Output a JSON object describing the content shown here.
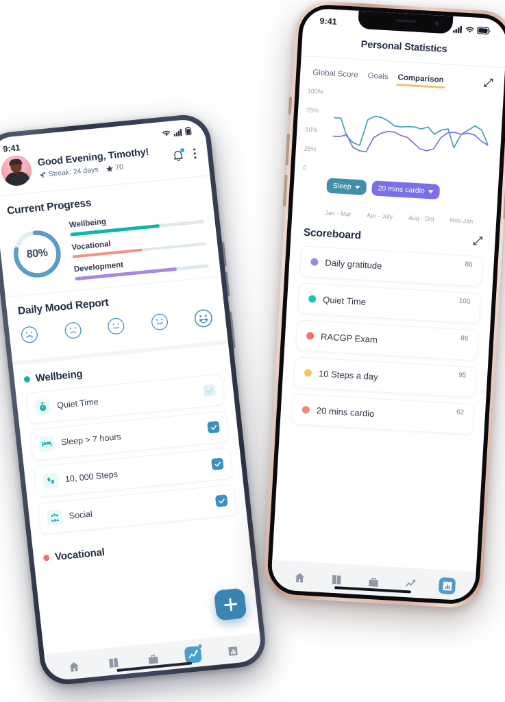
{
  "left_phone": {
    "status": {
      "time": "9:41",
      "icons": [
        "wifi-icon",
        "signal-icon",
        "battery-icon"
      ]
    },
    "header": {
      "greeting": "Good Evening, Timothy!",
      "streak_label": "Streak: 24 days",
      "streak_icon": "rocket-icon",
      "points": "70",
      "points_icon": "star-icon",
      "bell_icon": "bell-icon",
      "menu_icon": "kebab-menu-icon"
    },
    "progress": {
      "title": "Current Progress",
      "donut_value": "80%",
      "donut_percent": 80,
      "donut_color": "#5d9cc4",
      "bars": [
        {
          "label": "Wellbeing",
          "percent": 67,
          "color": "#0fb6b0"
        },
        {
          "label": "Vocational",
          "percent": 52,
          "color": "#f29189"
        },
        {
          "label": "Development",
          "percent": 76,
          "color": "#a78ae0"
        }
      ]
    },
    "mood": {
      "title": "Daily Mood Report",
      "faces": [
        {
          "name": "mood-sad-icon",
          "selected": false
        },
        {
          "name": "mood-slightly-sad-icon",
          "selected": false
        },
        {
          "name": "mood-neutral-icon",
          "selected": false
        },
        {
          "name": "mood-slightly-happy-icon",
          "selected": false
        },
        {
          "name": "mood-very-happy-icon",
          "selected": true
        }
      ]
    },
    "categories": [
      {
        "name": "Wellbeing",
        "color": "#0fb6b0",
        "tasks": [
          {
            "label": "Quiet Time",
            "icon": "stopwatch-icon",
            "checked": false
          },
          {
            "label": "Sleep > 7 hours",
            "icon": "bed-icon",
            "checked": true
          },
          {
            "label": "10, 000 Steps",
            "icon": "footsteps-icon",
            "checked": true
          },
          {
            "label": "Social",
            "icon": "people-icon",
            "checked": true
          }
        ]
      },
      {
        "name": "Vocational",
        "color": "#f2716d",
        "tasks": []
      }
    ],
    "fab": {
      "label": "+",
      "icon": "plus-icon"
    },
    "tabbar": [
      {
        "name": "tab-home",
        "icon": "home-icon",
        "active": false
      },
      {
        "name": "tab-journal",
        "icon": "book-icon",
        "active": false
      },
      {
        "name": "tab-toolkit",
        "icon": "briefcase-icon",
        "active": false
      },
      {
        "name": "tab-progress",
        "icon": "trend-up-icon",
        "active": true
      },
      {
        "name": "tab-stats",
        "icon": "bar-chart-icon",
        "active": false
      }
    ]
  },
  "right_phone": {
    "status": {
      "time": "9:41",
      "icons": [
        "signal-icon",
        "wifi-icon",
        "battery-icon"
      ]
    },
    "title": "Personal Statistics",
    "tabs": [
      {
        "label": "Global Score",
        "active": false
      },
      {
        "label": "Goals",
        "active": false
      },
      {
        "label": "Comparison",
        "active": true
      }
    ],
    "tab_underline_color": "#f7bf63",
    "expand_icon": "expand-diagonal-icon",
    "selectors": [
      {
        "label": "Sleep",
        "color": "#3f8fa8",
        "icon": "chevron-down-icon"
      },
      {
        "label": "20 mins cardio",
        "color": "#7b6fe8",
        "icon": "chevron-down-icon"
      }
    ],
    "scoreboard": {
      "title": "Scoreboard",
      "expand_icon": "expand-diagonal-icon",
      "items": [
        {
          "label": "Daily gratitude",
          "value": "86",
          "color": "#a184e8"
        },
        {
          "label": "Quiet Time",
          "value": "100",
          "color": "#14c4bd"
        },
        {
          "label": "RACGP Exam",
          "value": "86",
          "color": "#f2716d"
        },
        {
          "label": "10 Steps a day",
          "value": "95",
          "color": "#f7c45c"
        },
        {
          "label": "20 mins cardio",
          "value": "62",
          "color": "#f2847e"
        }
      ]
    },
    "tabbar": [
      {
        "name": "tab-home",
        "icon": "home-icon",
        "active": false
      },
      {
        "name": "tab-journal",
        "icon": "book-icon",
        "active": false
      },
      {
        "name": "tab-toolkit",
        "icon": "briefcase-icon",
        "active": false
      },
      {
        "name": "tab-progress",
        "icon": "trend-up-icon",
        "active": false
      },
      {
        "name": "tab-stats",
        "icon": "bar-chart-icon",
        "active": true
      }
    ]
  },
  "chart_data": {
    "type": "line",
    "title": "",
    "xlabel": "",
    "ylabel": "",
    "ylim": [
      0,
      100
    ],
    "ytick_labels": [
      "100%",
      "75%",
      "50%",
      "25%",
      "0"
    ],
    "ytick_values": [
      100,
      75,
      50,
      25,
      0
    ],
    "categories": [
      "Jan - Mar",
      "Apr - July",
      "Aug - Oct",
      "Nov-Jan"
    ],
    "grid": false,
    "legend": "below-chart-as-dropdown-pills",
    "series": [
      {
        "name": "Sleep",
        "color": "#4a9ab8",
        "values": [
          68,
          68,
          45,
          37,
          34,
          68,
          73,
          72,
          68,
          62,
          61,
          62,
          62,
          60,
          63,
          54,
          60,
          62,
          38,
          56,
          62,
          68,
          63,
          45
        ]
      },
      {
        "name": "20 mins cardio",
        "color": "#7b6fe8",
        "values": [
          44,
          44,
          47,
          31,
          27,
          26,
          45,
          51,
          54,
          54,
          50,
          48,
          41,
          34,
          32,
          35,
          50,
          57,
          58,
          56,
          58,
          56,
          49,
          44
        ]
      }
    ]
  }
}
